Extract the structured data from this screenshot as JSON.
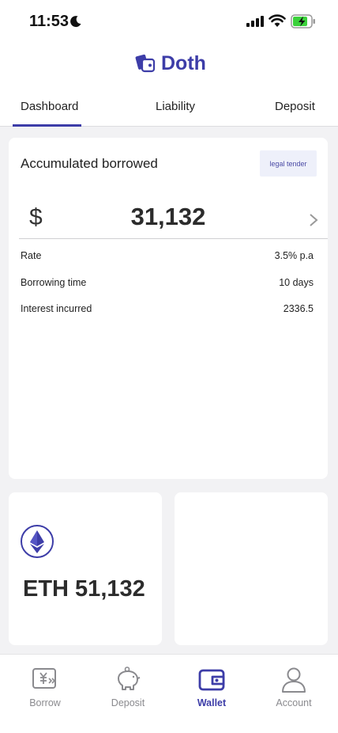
{
  "status_bar": {
    "time": "11:53",
    "icons": [
      "moon-icon",
      "signal-icon",
      "wifi-icon",
      "battery-charging-icon"
    ]
  },
  "header": {
    "brand_name": "Doth",
    "logo_icon": "wallet-cards-icon",
    "brand_color": "#3d3da8"
  },
  "tabs": [
    {
      "label": "Dashboard",
      "active": true
    },
    {
      "label": "Liability",
      "active": false
    },
    {
      "label": "Deposit",
      "active": false
    }
  ],
  "main_card": {
    "title": "Accumulated borrowed",
    "chip_label": "legal tender",
    "currency_symbol": "$",
    "amount": "31,132",
    "rows": [
      {
        "label": "Rate",
        "value": "3.5% p.a"
      },
      {
        "label": "Borrowing time",
        "value": "10 days"
      },
      {
        "label": "Interest incurred",
        "value": "2336.5"
      }
    ]
  },
  "eth_card": {
    "icon": "ethereum-icon",
    "balance": "ETH 51,132"
  },
  "bottom_nav": [
    {
      "label": "Borrow",
      "icon": "borrow-icon",
      "active": false
    },
    {
      "label": "Deposit",
      "icon": "piggy-bank-icon",
      "active": false
    },
    {
      "label": "Wallet",
      "icon": "wallet-icon",
      "active": true
    },
    {
      "label": "Account",
      "icon": "account-icon",
      "active": false
    }
  ],
  "colors": {
    "accent": "#3d3da8",
    "chip_background": "#eef0fa",
    "inactive_nav": "#8a8a8e"
  }
}
